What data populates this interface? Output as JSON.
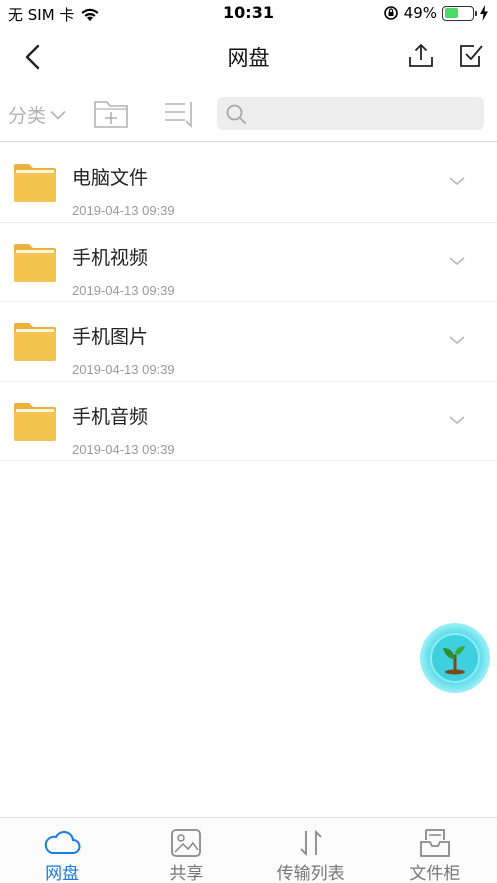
{
  "status_bar": {
    "carrier": "无 SIM 卡",
    "time": "10:31",
    "battery_percent": "49%",
    "battery_level": 0.49,
    "battery_color": "#4cd964"
  },
  "nav": {
    "title": "网盘",
    "back_icon": "chevron-left-icon",
    "upload_icon": "upload-icon",
    "select_icon": "checkbox-icon"
  },
  "toolbar": {
    "category_label": "分类",
    "new_folder_icon": "new-folder-icon",
    "sort_icon": "sort-icon",
    "search_placeholder": ""
  },
  "files": [
    {
      "name": "电脑文件",
      "date": "2019-04-13 09:39"
    },
    {
      "name": "手机视频",
      "date": "2019-04-13 09:39"
    },
    {
      "name": "手机图片",
      "date": "2019-04-13 09:39"
    },
    {
      "name": "手机音频",
      "date": "2019-04-13 09:39"
    }
  ],
  "tabs": [
    {
      "label": "网盘",
      "icon": "cloud-icon",
      "active": true
    },
    {
      "label": "共享",
      "icon": "share-icon",
      "active": false
    },
    {
      "label": "传输列表",
      "icon": "transfer-icon",
      "active": false
    },
    {
      "label": "文件柜",
      "icon": "cabinet-icon",
      "active": false
    }
  ],
  "colors": {
    "accent": "#1a7be0",
    "folder": "#f5c450",
    "inactive_text": "#b3b3b3"
  }
}
